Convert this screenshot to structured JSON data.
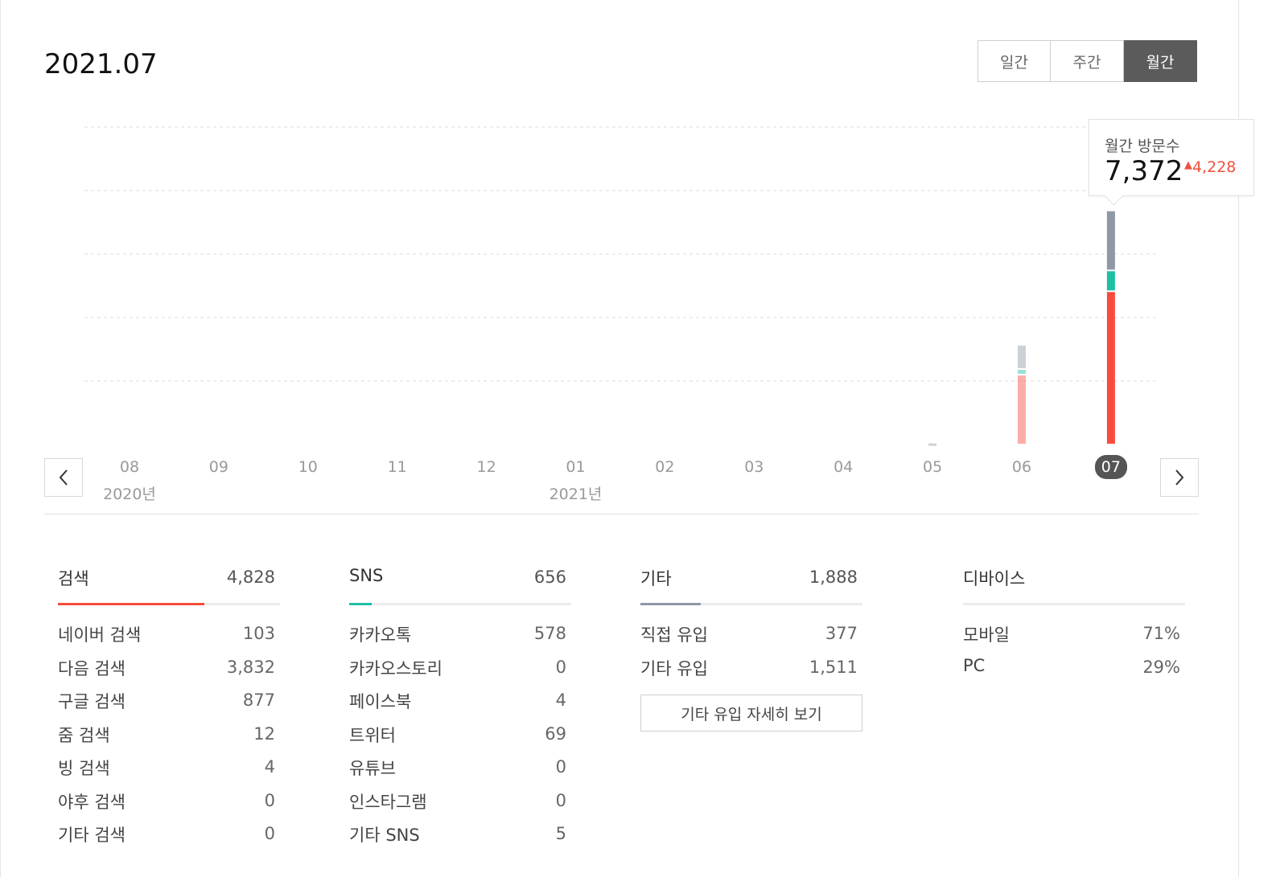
{
  "title": "2021.07",
  "period_tabs": [
    {
      "label": "일간",
      "active": false
    },
    {
      "label": "주간",
      "active": false
    },
    {
      "label": "월간",
      "active": true
    }
  ],
  "chart_data": {
    "type": "bar",
    "stacked": true,
    "categories": [
      "08",
      "09",
      "10",
      "11",
      "12",
      "01",
      "02",
      "03",
      "04",
      "05",
      "06",
      "07"
    ],
    "year_labels": [
      {
        "at": "08",
        "label": "2020년"
      },
      {
        "at": "01",
        "label": "2021년"
      }
    ],
    "selected": "07",
    "series": [
      {
        "key": "search",
        "color": "#f74c3c",
        "values": [
          0,
          0,
          0,
          0,
          0,
          0,
          0,
          0,
          0,
          0,
          2200,
          4828
        ]
      },
      {
        "key": "sns",
        "color": "#1fbfa5",
        "values": [
          0,
          0,
          0,
          0,
          0,
          0,
          0,
          0,
          0,
          0,
          180,
          656
        ]
      },
      {
        "key": "other",
        "color": "#8f98a6",
        "values": [
          0,
          0,
          0,
          0,
          0,
          0,
          0,
          0,
          0,
          60,
          764,
          1888
        ]
      }
    ],
    "totals": [
      0,
      0,
      0,
      0,
      0,
      0,
      0,
      0,
      0,
      60,
      3144,
      7372
    ],
    "ylim": [
      0,
      10000
    ],
    "grid": true
  },
  "tooltip": {
    "label": "월간 방문수",
    "value": "7,372",
    "change": "4,228"
  },
  "stats": {
    "search": {
      "title": "검색",
      "total": "4,828",
      "color": "#f74c3c",
      "share": 0.66,
      "rows": [
        {
          "label": "네이버 검색",
          "value": "103"
        },
        {
          "label": "다음 검색",
          "value": "3,832"
        },
        {
          "label": "구글 검색",
          "value": "877"
        },
        {
          "label": "줌 검색",
          "value": "12"
        },
        {
          "label": "빙 검색",
          "value": "4"
        },
        {
          "label": "야후 검색",
          "value": "0"
        },
        {
          "label": "기타 검색",
          "value": "0"
        }
      ]
    },
    "sns": {
      "title": "SNS",
      "total": "656",
      "color": "#1fbfa5",
      "share": 0.1,
      "rows": [
        {
          "label": "카카오톡",
          "value": "578"
        },
        {
          "label": "카카오스토리",
          "value": "0"
        },
        {
          "label": "페이스북",
          "value": "4"
        },
        {
          "label": "트위터",
          "value": "69"
        },
        {
          "label": "유튜브",
          "value": "0"
        },
        {
          "label": "인스타그램",
          "value": "0"
        },
        {
          "label": "기타 SNS",
          "value": "5"
        }
      ]
    },
    "other": {
      "title": "기타",
      "total": "1,888",
      "color": "#8f98a6",
      "share": 0.27,
      "rows": [
        {
          "label": "직접 유입",
          "value": "377"
        },
        {
          "label": "기타 유입",
          "value": "1,511"
        }
      ],
      "detail_button": "기타 유입 자세히 보기"
    },
    "device": {
      "title": "디바이스",
      "rows": [
        {
          "label": "모바일",
          "value": "71%"
        },
        {
          "label": "PC",
          "value": "29%"
        }
      ]
    }
  }
}
